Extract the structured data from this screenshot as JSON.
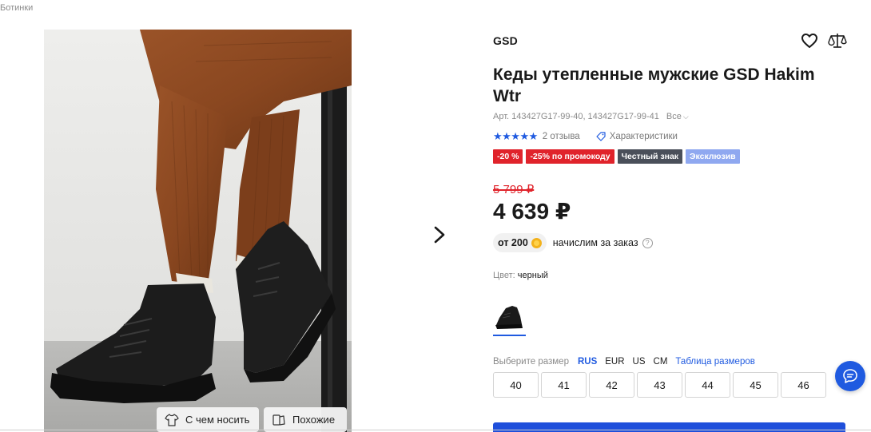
{
  "breadcrumb": "Ботинки",
  "photo": {
    "wear_with_label": "С чем носить",
    "similar_label": "Похожие",
    "next_icon": "chevron-right-icon"
  },
  "product": {
    "brand": "GSD",
    "title": "Кеды утепленные мужские GSD Hakim Wtr",
    "article": "Арт. 143427G17-99-40, 143427G17-99-41",
    "article_all": "Все",
    "rating": 5,
    "rating_color": "#1f5ae0",
    "reviews": "2 отзыва",
    "characteristics": "Характеристики"
  },
  "badges": [
    {
      "text": "-20 %",
      "color": "#e0232b"
    },
    {
      "text": "-25% по промокоду",
      "color": "#e0232b"
    },
    {
      "text": "Честный знак",
      "color": "#4a4f5a"
    },
    {
      "text": "Эксклюзив",
      "color": "#8fa8f0"
    }
  ],
  "price": {
    "old": "5 799 ₽",
    "current": "4 639 ₽",
    "old_color": "#e0232b"
  },
  "bonus": {
    "amount": "от 200",
    "text": "начислим за заказ",
    "help": "?"
  },
  "color": {
    "label": "Цвет:",
    "value": "черный"
  },
  "size": {
    "label": "Выберите размер",
    "systems": [
      "RUS",
      "EUR",
      "US",
      "CM"
    ],
    "active_system": "RUS",
    "table_link": "Таблица размеров",
    "options": [
      "40",
      "41",
      "42",
      "43",
      "44",
      "45",
      "46"
    ]
  },
  "colors": {
    "accent": "#1f5ae0",
    "buy_button": "#1f4fdb"
  },
  "icons": {
    "favorite": "heart-icon",
    "compare": "scales-icon",
    "chat": "chat-icon"
  }
}
